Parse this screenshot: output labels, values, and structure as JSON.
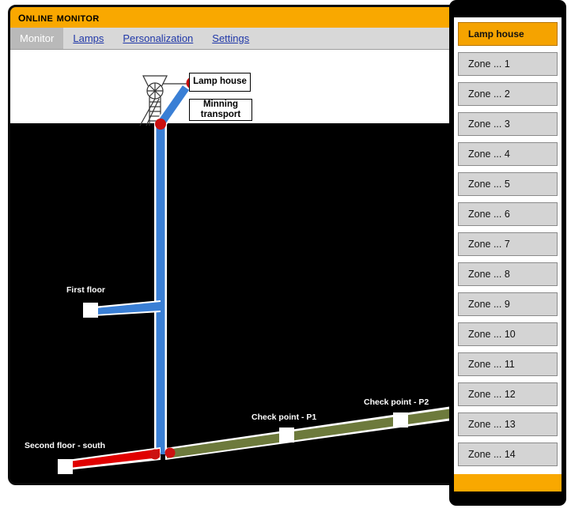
{
  "window": {
    "title": "Online monitor"
  },
  "tabs": [
    {
      "label": "Monitor",
      "active": true
    },
    {
      "label": "Lamps",
      "active": false
    },
    {
      "label": "Personalization",
      "active": false
    },
    {
      "label": "Settings",
      "active": false
    }
  ],
  "diagram": {
    "surface_labels": [
      {
        "text": "Lamp house"
      },
      {
        "text": "Minning transport"
      }
    ],
    "underground_labels": [
      {
        "text": "First floor"
      },
      {
        "text": "Second floor - south"
      },
      {
        "text": "Check point - P1"
      },
      {
        "text": "Check point - P2"
      }
    ],
    "colors": {
      "shaft_blue": "#3a7fd5",
      "tunnel_green": "#6d7a3c",
      "tunnel_red": "#e00000",
      "marker_red": "#cc1111",
      "marker_white": "#ffffff",
      "background": "#000000",
      "surface": "#ffffff"
    }
  },
  "zone_panel": {
    "items": [
      {
        "label": "Lamp house",
        "selected": true
      },
      {
        "label": "Zone ... 1",
        "selected": false
      },
      {
        "label": "Zone ... 2",
        "selected": false
      },
      {
        "label": "Zone ... 3",
        "selected": false
      },
      {
        "label": "Zone ... 4",
        "selected": false
      },
      {
        "label": "Zone ... 5",
        "selected": false
      },
      {
        "label": "Zone ... 6",
        "selected": false
      },
      {
        "label": "Zone ... 7",
        "selected": false
      },
      {
        "label": "Zone ... 8",
        "selected": false
      },
      {
        "label": "Zone ... 9",
        "selected": false
      },
      {
        "label": "Zone ... 10",
        "selected": false
      },
      {
        "label": "Zone ... 11",
        "selected": false
      },
      {
        "label": "Zone ... 12",
        "selected": false
      },
      {
        "label": "Zone ... 13",
        "selected": false
      },
      {
        "label": "Zone ... 14",
        "selected": false
      }
    ]
  },
  "theme": {
    "accent": "#f9a800",
    "tab_link": "#2038a8",
    "tab_active_bg": "#b9b9b9",
    "tab_bar_bg": "#d8d8d8"
  }
}
